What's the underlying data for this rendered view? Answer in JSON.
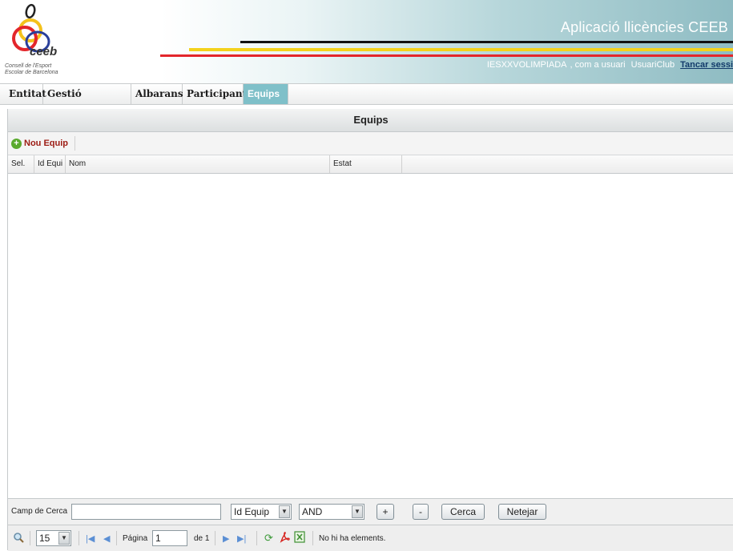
{
  "header": {
    "app_title": "Aplicació llicències CEEB",
    "user_name": "IESXXVOLIMPIADA",
    "role_text": ", com a usuari",
    "role": "UsuariClub",
    "logout_label": "Tancar sessi",
    "logo_word": "ceeb",
    "logo_caption_1": "Consell de l'Esport",
    "logo_caption_2": "Escolar de Barcelona"
  },
  "menu": {
    "items": [
      {
        "label": "Entitat"
      },
      {
        "label": "Gestió Llicències"
      },
      {
        "label": "Albarans"
      },
      {
        "label": "Participants"
      },
      {
        "label": "Equips"
      }
    ],
    "active": "Equips"
  },
  "panel": {
    "title": "Equips",
    "new_button_label": "Nou Equip",
    "new_button_icon": "add-circle-icon",
    "columns": [
      "Sel.",
      "Id Equi",
      "Nom",
      "Estat"
    ],
    "rows": []
  },
  "search": {
    "label": "Camp de Cerca",
    "value": "",
    "field_select": "Id Equip",
    "operator_select": "AND",
    "add_label": "+",
    "remove_label": "-",
    "search_label": "Cerca",
    "clear_label": "Netejar"
  },
  "pager": {
    "page_size": "15",
    "page_label": "Página",
    "page_value": "1",
    "of_label": "de 1",
    "status": "No hi ha elements."
  },
  "colors": {
    "accent": "#7fc0c9",
    "new_button": "#9c1a12",
    "stripe_red": "#e3262b",
    "stripe_yellow": "#f4d21c"
  }
}
